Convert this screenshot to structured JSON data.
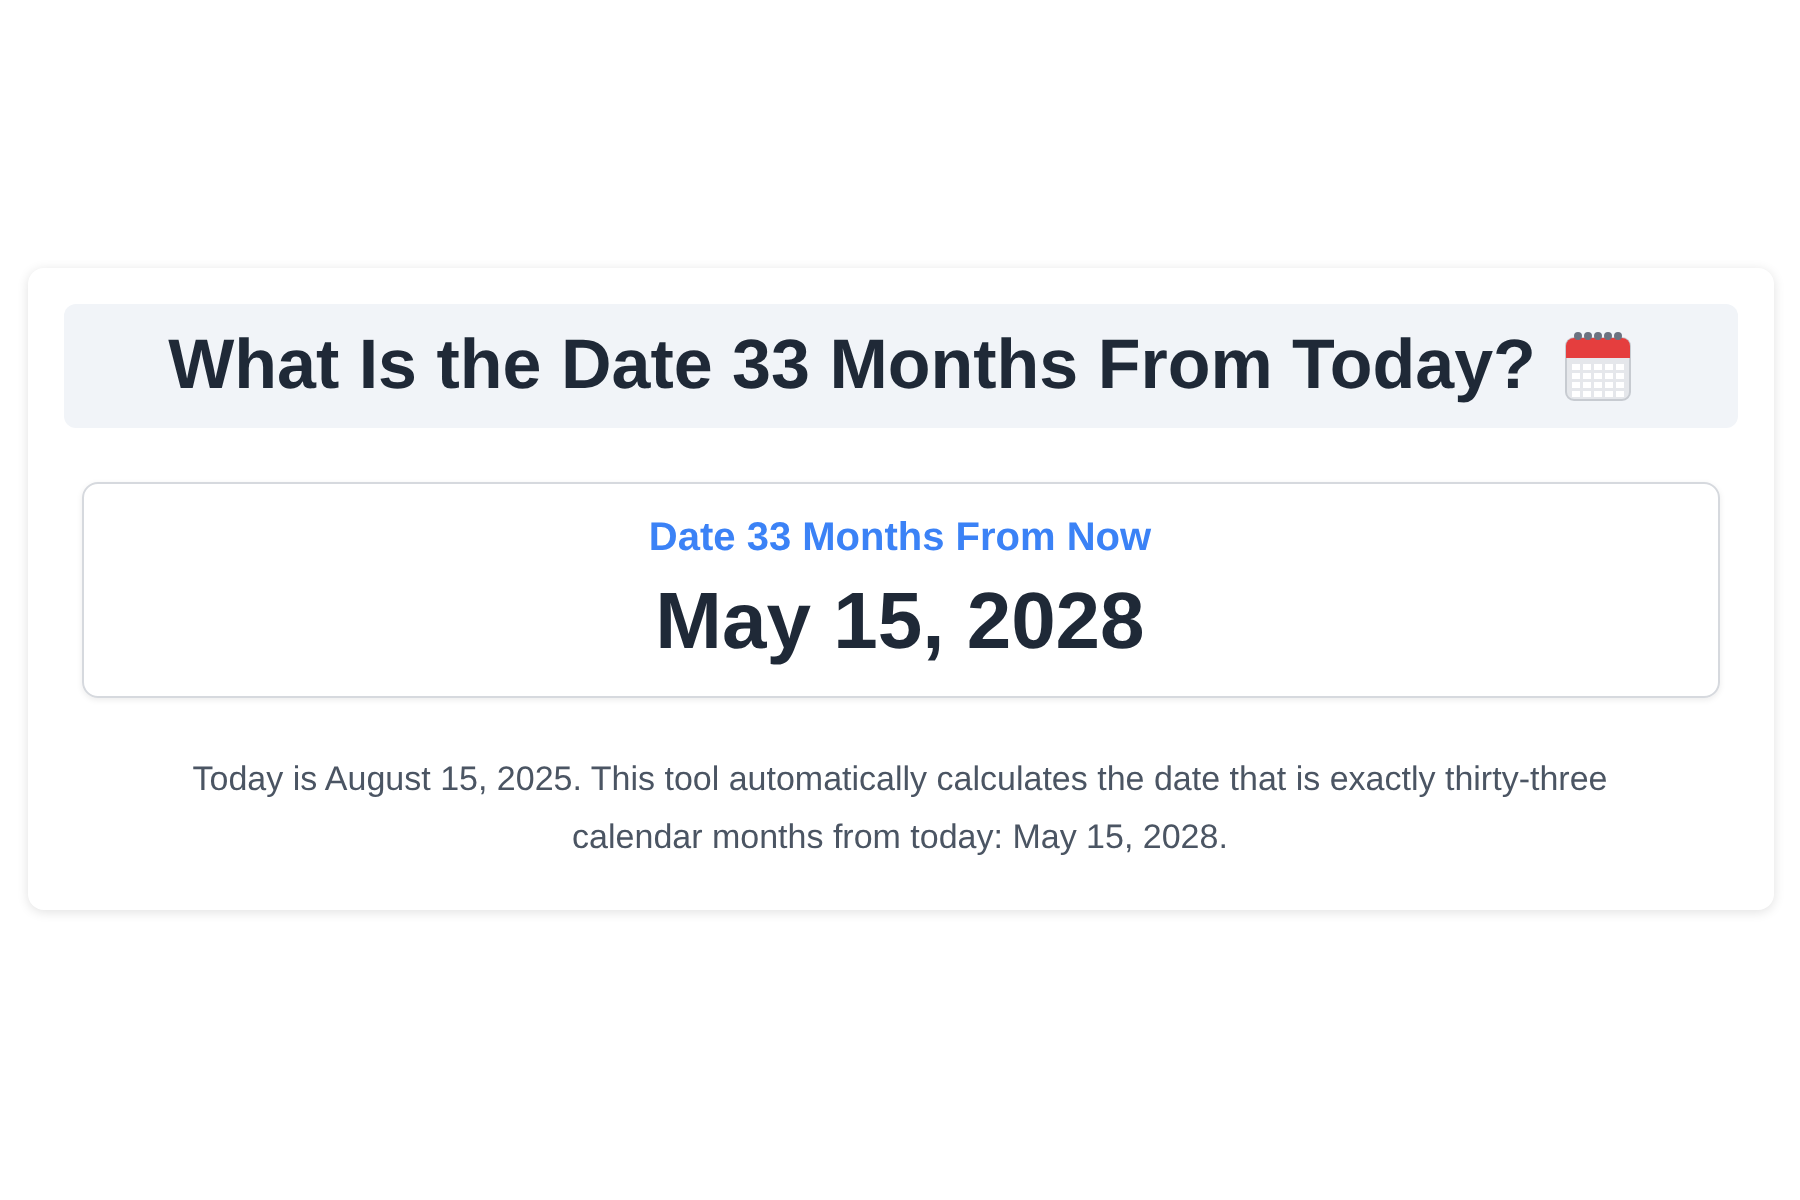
{
  "title": "What Is the Date 33 Months From Today?",
  "result": {
    "label": "Date 33 Months From Now",
    "date": "May 15, 2028"
  },
  "description": "Today is August 15, 2025. This tool automatically calculates the date that is exactly thirty-three calendar months from today: May 15, 2028."
}
